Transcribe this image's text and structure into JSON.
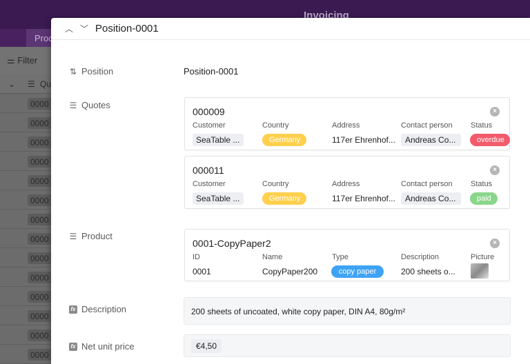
{
  "background": {
    "header_title": "Invoicing",
    "tab_label": "Prod",
    "filter_label": "Filter",
    "column_header": "Qu",
    "rows": [
      "0000",
      "0000",
      "0000",
      "0000",
      "0000",
      "0000",
      "0000",
      "0000",
      "0000",
      "0000",
      "0000",
      "0000",
      "0000",
      "0000"
    ]
  },
  "dialog": {
    "title": "Position-0001",
    "fields": {
      "position": {
        "label": "Position",
        "value": "Position-0001"
      },
      "quotes": {
        "label": "Quotes",
        "cards": [
          {
            "title": "000009",
            "columns": [
              "Customer",
              "Country",
              "Address",
              "Contact person",
              "Status"
            ],
            "customer": "SeaTable ...",
            "country": "Germany",
            "address": "117er Ehrenhof...",
            "contact": "Andreas Co...",
            "status": "overdue"
          },
          {
            "title": "000011",
            "columns": [
              "Customer",
              "Country",
              "Address",
              "Contact person",
              "Status"
            ],
            "customer": "SeaTable ...",
            "country": "Germany",
            "address": "117er Ehrenhof...",
            "contact": "Andreas Co...",
            "status": "paid"
          }
        ]
      },
      "product": {
        "label": "Product",
        "card": {
          "title": "0001-CopyPaper2",
          "columns": [
            "ID",
            "Name",
            "Type",
            "Description",
            "Picture"
          ],
          "id": "0001",
          "name": "CopyPaper200",
          "type": "copy paper",
          "description": "200 sheets o..."
        }
      },
      "description": {
        "label": "Description",
        "value": "200 sheets of uncoated, white copy paper, DIN A4, 80g/m²"
      },
      "net_unit_price": {
        "label": "Net unit price",
        "value": "€4,50"
      }
    }
  },
  "colors": {
    "header_bg": "#3b1a52",
    "status_overdue": "#f25b6b",
    "status_paid": "#8ad68a",
    "country_chip": "#ffd04d",
    "type_chip": "#3ea3f5"
  }
}
